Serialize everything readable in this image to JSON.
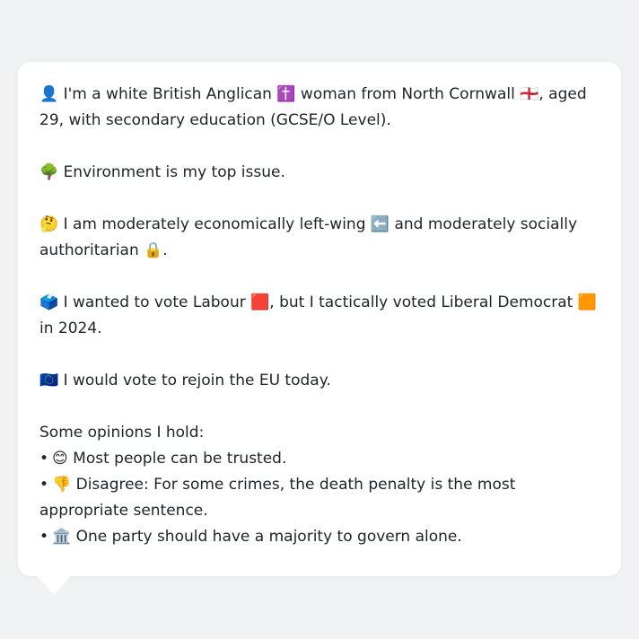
{
  "bio": {
    "identity": "👤 I'm a white British Anglican ✝️ woman from North Cornwall 🏴󠁧󠁢󠁥󠁮󠁧󠁿, aged 29, with secondary education (GCSE/O Level).",
    "top_issue": "🌳 Environment is my top issue.",
    "ideology": "🤔 I am moderately economically left-wing ⬅️ and moderately socially authoritarian 🔒.",
    "vote": "🗳️ I wanted to vote Labour 🟥, but I tactically voted Liberal Democrat 🟧 in 2024.",
    "eu": "🇪🇺 I would vote to rejoin the EU today."
  },
  "opinions": {
    "heading": "Some opinions I hold:",
    "bullet_char": "•",
    "items": [
      "😊 Most people can be trusted.",
      "👎 Disagree: For some crimes, the death penalty is the most appropriate sentence.",
      "🏛️ One party should have a majority to govern alone."
    ]
  }
}
